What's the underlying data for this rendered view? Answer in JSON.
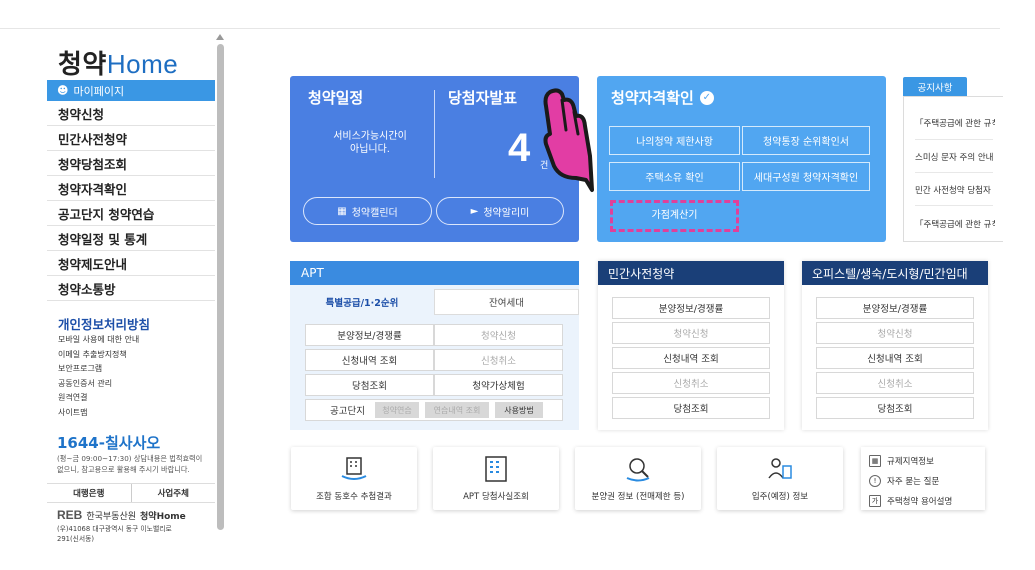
{
  "sidebar": {
    "logo_a": "청약",
    "logo_b": "Home",
    "mypage": "마이페이지",
    "menu": [
      "청약신청",
      "민간사전청약",
      "청약당첨조회",
      "청약자격확인",
      "공고단지 청약연습",
      "청약일정 및 통계",
      "청약제도안내",
      "청약소통방"
    ],
    "privacy_title": "개인정보처리방침",
    "links": [
      "모바일 사용에 대한 안내",
      "이메일 추출방지정책",
      "보안프로그램",
      "공동인증서 관리",
      "원격연결",
      "사이트맵"
    ],
    "phone": "1644-칠사사오",
    "phone_desc_1": "(평~금 09:00~17:30) 상담내용은 법적효력이",
    "phone_desc_2": "없으니, 참고용으로 활용해 주시기 바랍니다.",
    "bank": "대행은행",
    "biz": "사업주체",
    "reb_logo": "REB",
    "reb_name": "한국부동산원",
    "reb_brand": "청약Home",
    "reb_addr_1": "(우)41068 대구광역시 동구 이노밸리로",
    "reb_addr_2": "291(신서동)"
  },
  "card1": {
    "title_left": "청약일정",
    "title_right": "당첨자발표",
    "msg_1": "서비스가능시간이",
    "msg_2": "아닙니다.",
    "count": "4",
    "unit": "건",
    "btn_calendar": "청약캘린더",
    "btn_alarm": "청약알리미"
  },
  "card2": {
    "title": "청약자격확인",
    "buttons": [
      "나의청약 제한사항",
      "청약통장 순위확인서",
      "주택소유 확인",
      "세대구성원 청약자격확인",
      "가점계산기"
    ]
  },
  "notice": {
    "tab": "공지사항",
    "items": [
      "「주택공급에 관한 규칙」",
      "스미싱 문자 주의 안내",
      "민간 사전청약 당첨자",
      "「주택공급에 관한 규칙」"
    ]
  },
  "apt": {
    "title": "APT",
    "tab_special": "특별공급/1·2순위",
    "tab_remain": "잔여세대",
    "rows": [
      [
        "분양정보/경쟁률",
        "청약신청"
      ],
      [
        "신청내역 조회",
        "신청취소"
      ],
      [
        "당첨조회",
        "청약가상체험"
      ]
    ],
    "practice_label": "공고단지",
    "practice_1": "청약연습",
    "practice_2": "연습내역 조회",
    "practice_3": "사용방법"
  },
  "private_pre": {
    "title": "민간사전청약",
    "items": [
      "분양정보/경쟁률",
      "청약신청",
      "신청내역 조회",
      "신청취소",
      "당첨조회"
    ]
  },
  "officetel": {
    "title": "오피스텔/생숙/도시형/민간임대",
    "items": [
      "분양정보/경쟁률",
      "청약신청",
      "신청내역 조회",
      "신청취소",
      "당첨조회"
    ]
  },
  "tiles": [
    "조합 동호수 추첨결과",
    "APT 당첨사실조회",
    "분양권 정보 (전매제한 등)",
    "입주(예정) 정보"
  ],
  "quick_links": [
    "규제지역정보",
    "자주 묻는 질문",
    "주택청약 용어설명"
  ],
  "colors": {
    "card1": "#4a7fe2",
    "card2": "#51a6f1",
    "apt_head": "#3a8be0",
    "dark_head": "#1a3f78",
    "highlight": "#e0409a"
  }
}
